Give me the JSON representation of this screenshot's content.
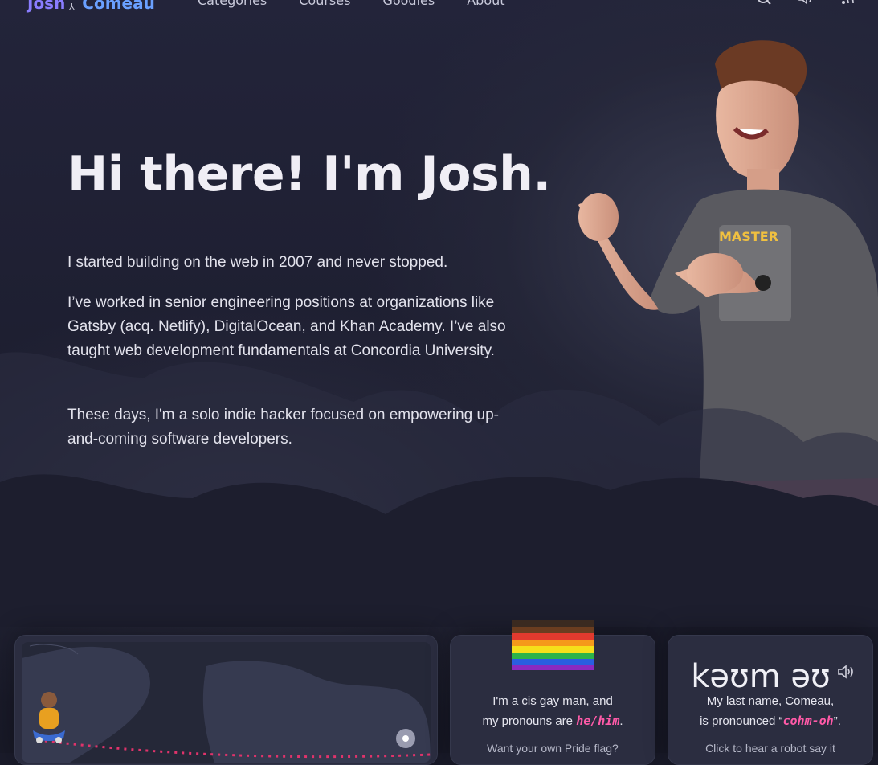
{
  "header": {
    "logo_first": "Josh",
    "logo_last": "Comeau",
    "nav": [
      "Categories",
      "Courses",
      "Goodies",
      "About"
    ],
    "icons": [
      "search-icon",
      "sound-icon",
      "rss-icon"
    ]
  },
  "hero": {
    "title": "Hi there! I'm Josh.",
    "p1": "I started building on the web in 2007 and never stopped.",
    "p2": "I’ve worked in senior engineering positions at organizations like Gatsby (acq. Netlify), DigitalOcean, and Khan Academy. I’ve also taught web development fundamentals at Concordia University.",
    "p3": "These days, I'm a solo indie hacker focused on empowering up-and-coming software developers."
  },
  "pride_card": {
    "line1": "I'm a cis gay man, and",
    "line2_prefix": "my pronouns are ",
    "pronouns": "he/him",
    "line2_suffix": ".",
    "footer": "Want your own Pride flag?"
  },
  "name_card": {
    "ipa": "kəʊm əʊ",
    "line1": "My last name, Comeau,",
    "line2_prefix": "is pronounced “",
    "pronounced": "cohm-oh",
    "line2_suffix": "”.",
    "footer": "Click to hear a robot say it"
  },
  "colors": {
    "accent": "#7c6cff",
    "pink": "#ff5aa8",
    "background": "#1a1b2a"
  }
}
